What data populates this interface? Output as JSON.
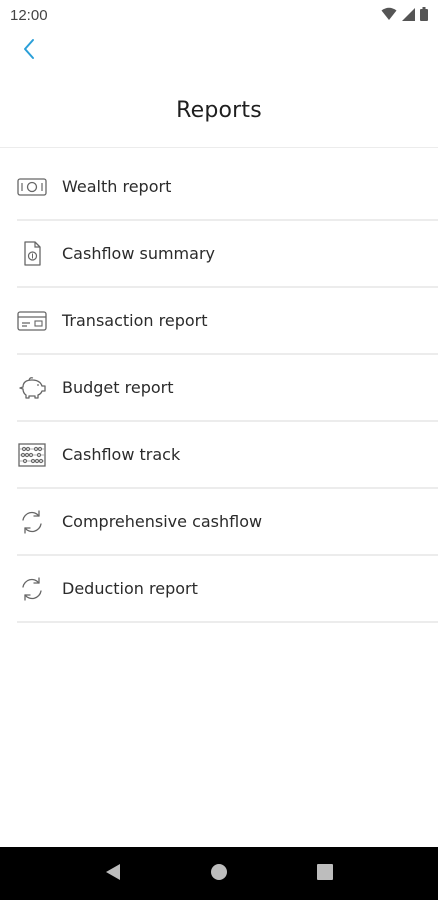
{
  "status_bar": {
    "time": "12:00",
    "icons": [
      "wifi-icon",
      "cell-signal-icon",
      "battery-icon"
    ]
  },
  "header": {
    "back_icon": "chevron-left-icon",
    "title": "Reports",
    "accent_color": "#2a9fd8"
  },
  "reports": [
    {
      "label": "Wealth report",
      "icon": "banknote-icon"
    },
    {
      "label": "Cashflow summary",
      "icon": "document-icon"
    },
    {
      "label": "Transaction report",
      "icon": "card-icon"
    },
    {
      "label": "Budget report",
      "icon": "piggy-bank-icon"
    },
    {
      "label": "Cashflow track",
      "icon": "abacus-icon"
    },
    {
      "label": "Comprehensive cashflow",
      "icon": "refresh-icon"
    },
    {
      "label": "Deduction report",
      "icon": "refresh-icon"
    }
  ],
  "nav_bar": {
    "buttons": [
      "back-triangle-icon",
      "home-circle-icon",
      "recents-square-icon"
    ]
  }
}
